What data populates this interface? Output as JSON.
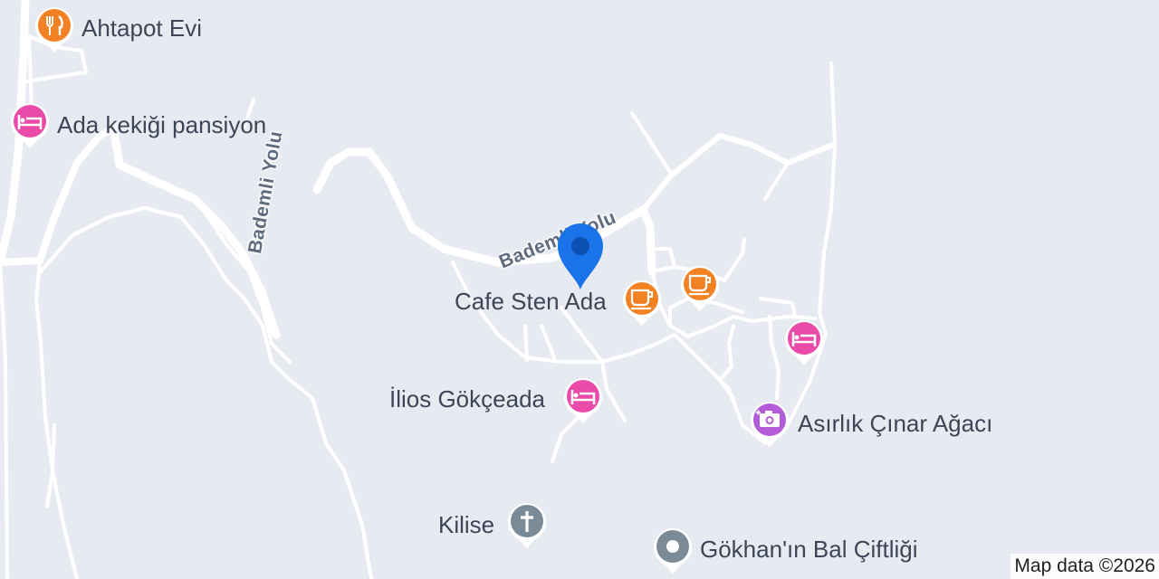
{
  "map": {
    "attribution": "Map data ©2026",
    "streets": [
      {
        "name": "Bademli Yolu"
      },
      {
        "name": "Bademli Yolu"
      }
    ],
    "location_pin": {
      "color": "#1a73e8",
      "icon": "location-pin-icon"
    },
    "pois": [
      {
        "label": "Ahtapot Evi",
        "category": "restaurant",
        "icon": "fork-knife-icon",
        "color": "#f28123"
      },
      {
        "label": "Ada kekiği pansiyon",
        "category": "lodging",
        "icon": "bed-icon",
        "color": "#ea4ba9"
      },
      {
        "label": "Cafe Sten Ada",
        "category": "cafe",
        "icon": "coffee-cup-icon",
        "color": "#f28123"
      },
      {
        "label": "",
        "category": "cafe",
        "icon": "coffee-cup-icon",
        "color": "#f28123"
      },
      {
        "label": "",
        "category": "lodging",
        "icon": "bed-icon",
        "color": "#ea4ba9"
      },
      {
        "label": "İlios Gökçeada",
        "category": "lodging",
        "icon": "bed-icon",
        "color": "#ea4ba9"
      },
      {
        "label": "Asırlık Çınar Ağacı",
        "category": "attraction",
        "icon": "camera-icon",
        "color": "#b45bd8"
      },
      {
        "label": "Kilise",
        "category": "church",
        "icon": "cross-icon",
        "color": "#7a8a96"
      },
      {
        "label": "Gökhan'ın Bal Çiftliği",
        "category": "place",
        "icon": "dot-icon",
        "color": "#7a8a96"
      }
    ]
  }
}
